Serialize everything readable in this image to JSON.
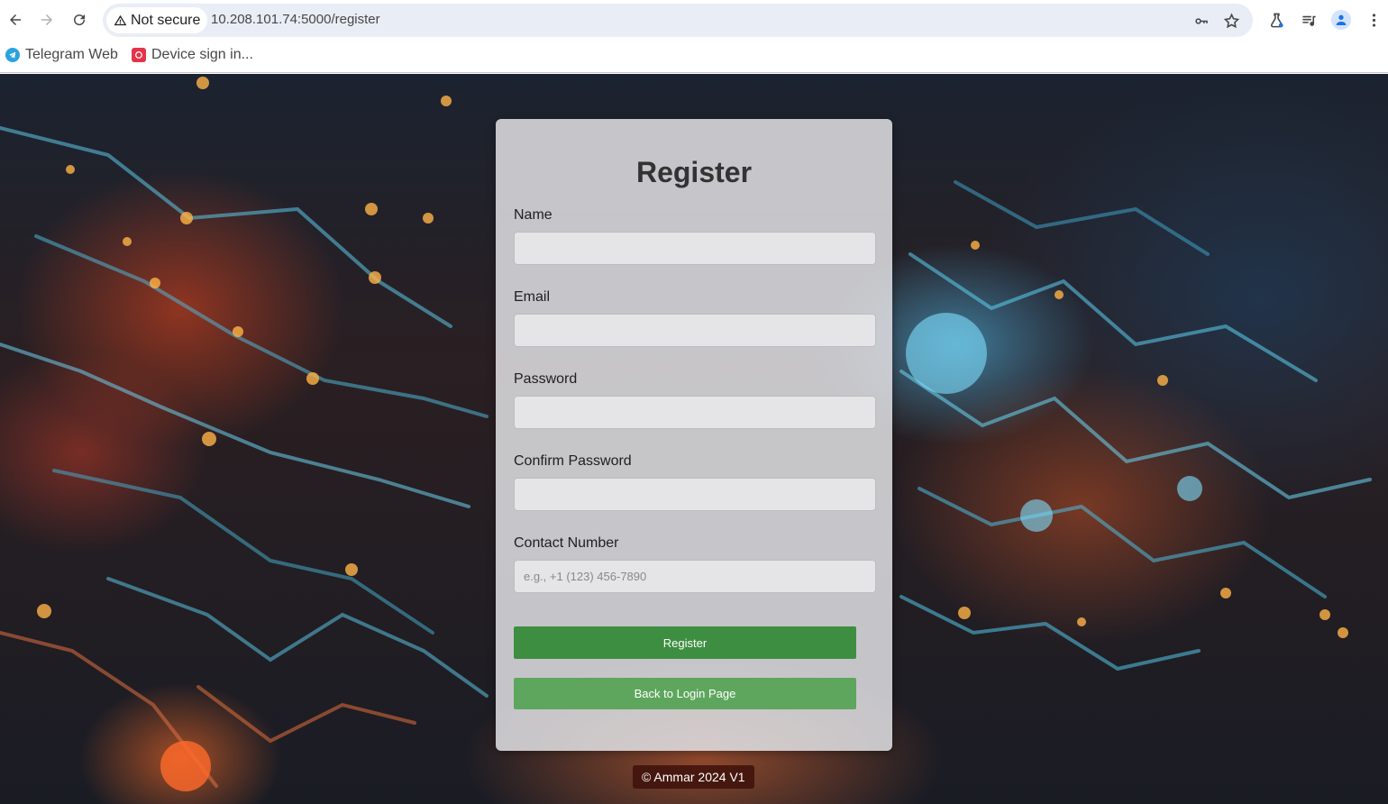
{
  "browser": {
    "security_label": "Not secure",
    "url": "10.208.101.74:5000/register",
    "bookmarks": [
      {
        "label": "Telegram Web",
        "icon": "telegram-icon"
      },
      {
        "label": "Device sign in...",
        "icon": "device-signin-icon"
      }
    ]
  },
  "form": {
    "title": "Register",
    "fields": [
      {
        "label": "Name",
        "placeholder": ""
      },
      {
        "label": "Email",
        "placeholder": ""
      },
      {
        "label": "Password",
        "placeholder": ""
      },
      {
        "label": "Confirm Password",
        "placeholder": ""
      },
      {
        "label": "Contact Number",
        "placeholder": "e.g., +1 (123) 456-7890"
      }
    ],
    "register_label": "Register",
    "back_label": "Back to Login Page"
  },
  "footer": {
    "text": "© Ammar 2024 V1"
  },
  "colors": {
    "register_button": "#3e8e41",
    "back_button": "#5ea65d",
    "card": "#e1e1e4"
  }
}
